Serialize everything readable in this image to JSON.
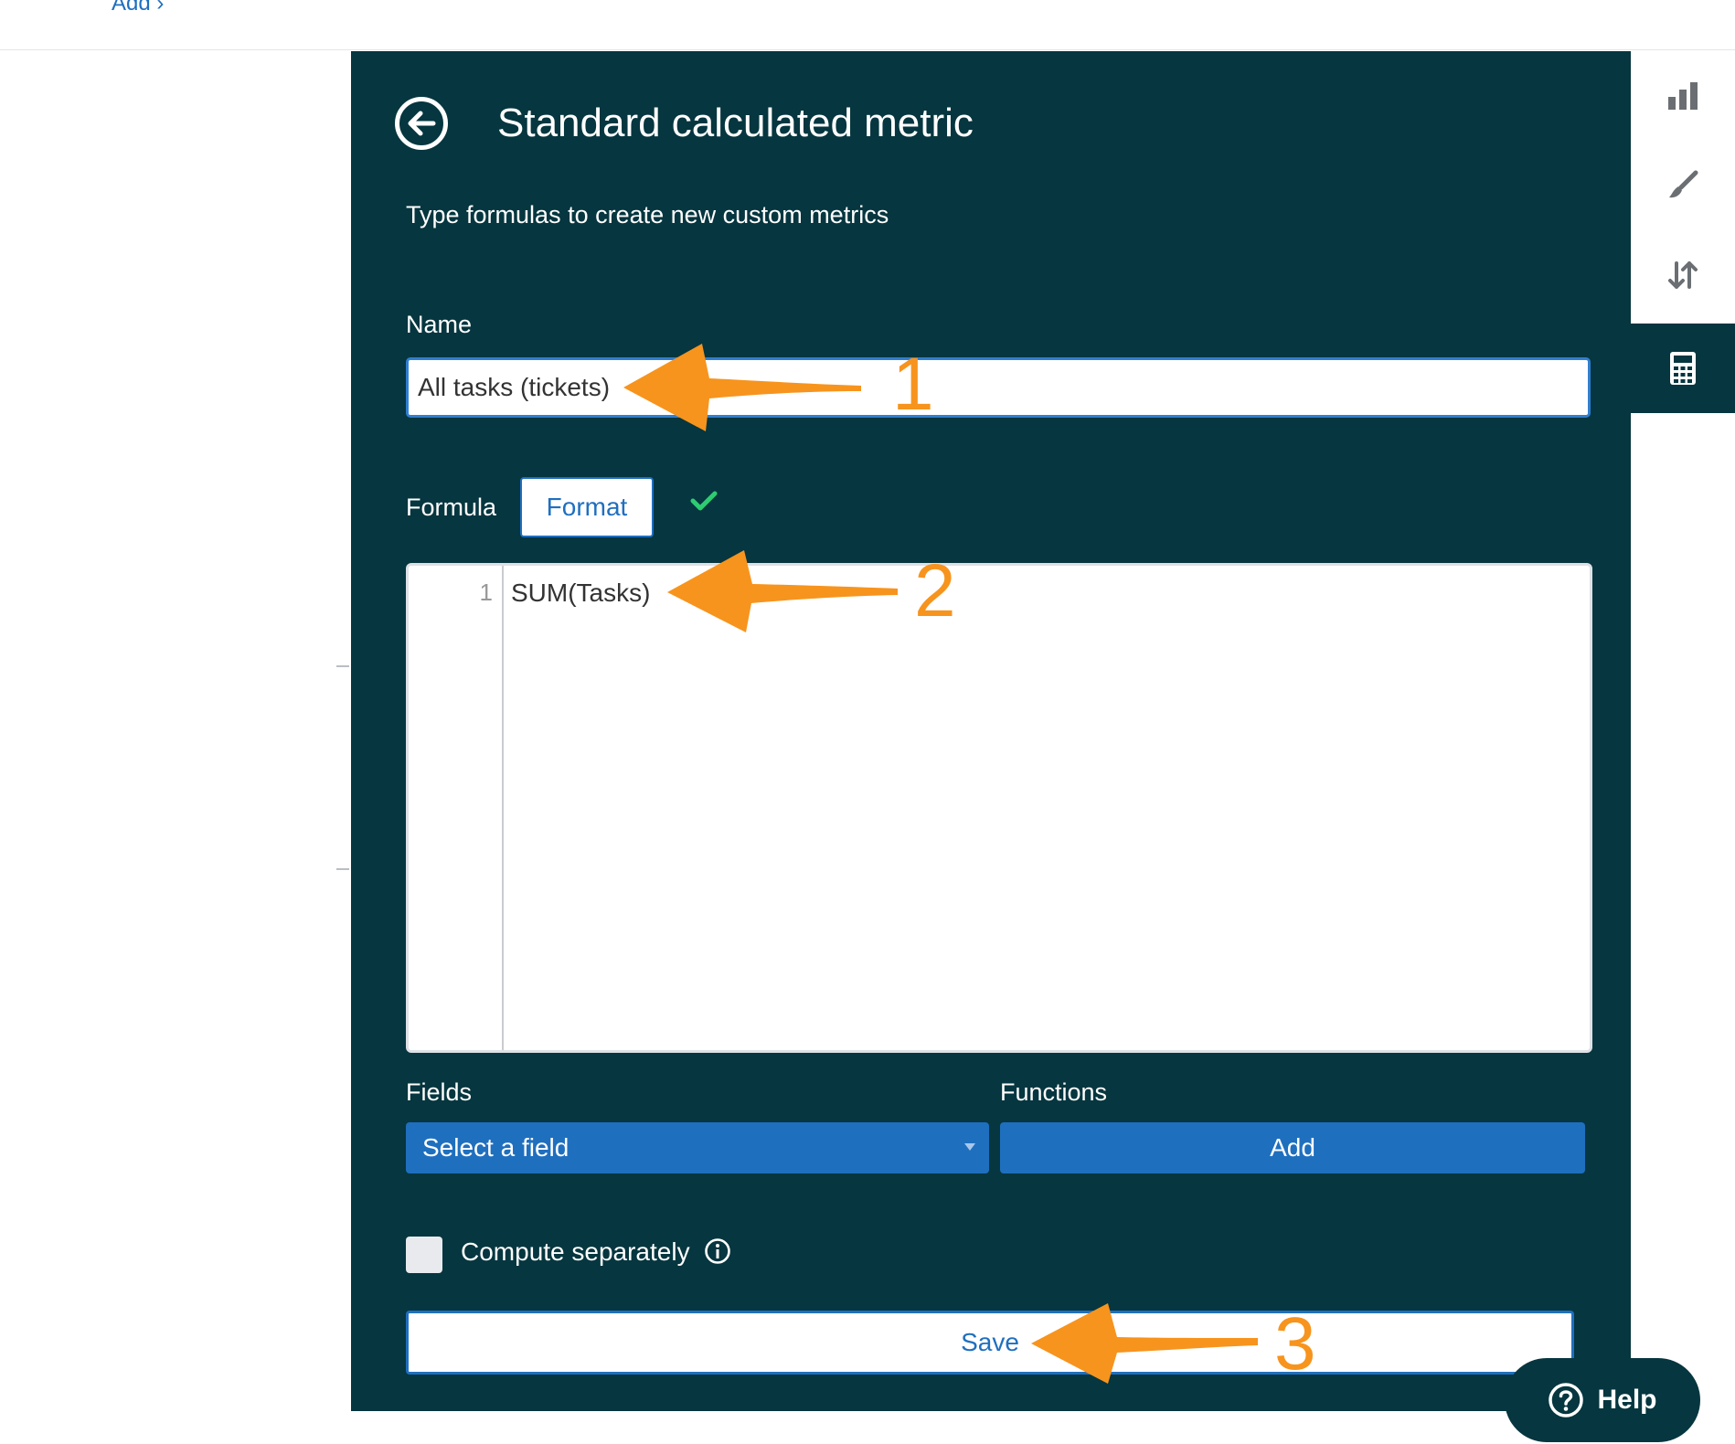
{
  "topbar": {
    "add_link": "Add ›"
  },
  "panel": {
    "title": "Standard calculated metric",
    "subtitle": "Type formulas to create new custom metrics",
    "name_label": "Name",
    "name_value": "All tasks (tickets)",
    "formula_label": "Formula",
    "format_button": "Format",
    "editor": {
      "line_number": "1",
      "code": "SUM(Tasks)"
    },
    "fields_label": "Fields",
    "functions_label": "Functions",
    "select_field": "Select a field",
    "add_button": "Add",
    "compute_separately": "Compute separately",
    "save_button": "Save"
  },
  "sidebar": {
    "icons": [
      "bar-chart-icon",
      "paint-brush-icon",
      "sort-icon",
      "calculator-icon"
    ],
    "active": "calculator-icon"
  },
  "help": {
    "label": "Help"
  },
  "annotations": [
    "1",
    "2",
    "3"
  ],
  "colors": {
    "panel_bg": "#06363f",
    "primary_blue": "#1f6fbf",
    "annotation_orange": "#f7941d",
    "valid_green": "#2ecc71"
  }
}
